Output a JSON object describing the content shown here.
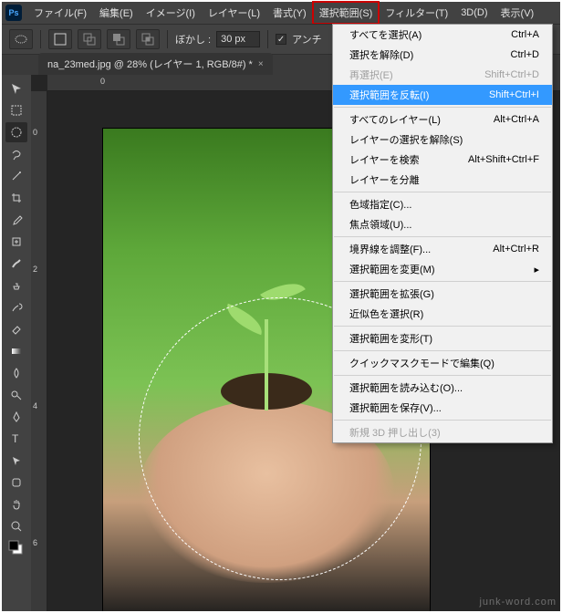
{
  "logo": "Ps",
  "menubar": [
    {
      "label": "ファイル(F)"
    },
    {
      "label": "編集(E)"
    },
    {
      "label": "イメージ(I)"
    },
    {
      "label": "レイヤー(L)"
    },
    {
      "label": "書式(Y)"
    },
    {
      "label": "選択範囲(S)",
      "active": true
    },
    {
      "label": "フィルター(T)"
    },
    {
      "label": "3D(D)"
    },
    {
      "label": "表示(V)"
    }
  ],
  "optionbar": {
    "feather_label": "ぼかし :",
    "feather_value": "30 px",
    "antialias_label": "アンチ"
  },
  "doc_tab": {
    "title": "na_23med.jpg @ 28% (レイヤー 1, RGB/8#) *",
    "close": "×"
  },
  "ruler_h": [
    "0"
  ],
  "ruler_v": [
    "0",
    "2",
    "4",
    "6"
  ],
  "dropdown_groups": [
    [
      {
        "label": "すべてを選択(A)",
        "shortcut": "Ctrl+A"
      },
      {
        "label": "選択を解除(D)",
        "shortcut": "Ctrl+D"
      },
      {
        "label": "再選択(E)",
        "shortcut": "Shift+Ctrl+D",
        "disabled": true
      },
      {
        "label": "選択範囲を反転(I)",
        "shortcut": "Shift+Ctrl+I",
        "highlight": true
      }
    ],
    [
      {
        "label": "すべてのレイヤー(L)",
        "shortcut": "Alt+Ctrl+A"
      },
      {
        "label": "レイヤーの選択を解除(S)",
        "shortcut": ""
      },
      {
        "label": "レイヤーを検索",
        "shortcut": "Alt+Shift+Ctrl+F"
      },
      {
        "label": "レイヤーを分離",
        "shortcut": ""
      }
    ],
    [
      {
        "label": "色域指定(C)...",
        "shortcut": ""
      },
      {
        "label": "焦点領域(U)...",
        "shortcut": ""
      }
    ],
    [
      {
        "label": "境界線を調整(F)...",
        "shortcut": "Alt+Ctrl+R"
      },
      {
        "label": "選択範囲を変更(M)",
        "shortcut": "▸"
      }
    ],
    [
      {
        "label": "選択範囲を拡張(G)",
        "shortcut": ""
      },
      {
        "label": "近似色を選択(R)",
        "shortcut": ""
      }
    ],
    [
      {
        "label": "選択範囲を変形(T)",
        "shortcut": ""
      }
    ],
    [
      {
        "label": "クイックマスクモードで編集(Q)",
        "shortcut": ""
      }
    ],
    [
      {
        "label": "選択範囲を読み込む(O)...",
        "shortcut": ""
      },
      {
        "label": "選択範囲を保存(V)...",
        "shortcut": ""
      }
    ],
    [
      {
        "label": "新規 3D 押し出し(3)",
        "shortcut": "",
        "disabled": true
      }
    ]
  ],
  "watermark": "junk-word.com"
}
